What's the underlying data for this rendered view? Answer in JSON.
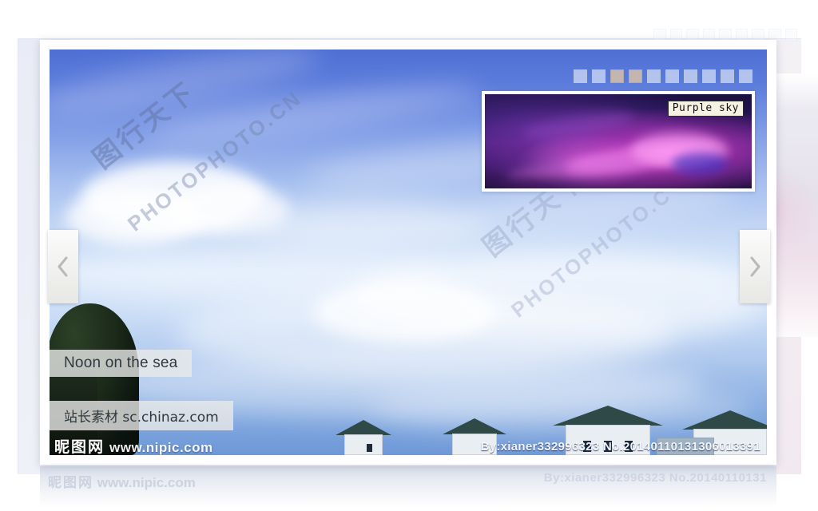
{
  "viewer": {
    "title": "Noon on the sea",
    "subtitle": "站长素材 sc.chinaz.com",
    "credit": "By:xianer332996323  No.20140110131306013391",
    "reflection_credit": "By:xianer332996323  No.20140110131",
    "prev_label": "‹",
    "next_label": "›",
    "prev_icon": "chevron-left-icon",
    "next_icon": "chevron-right-icon"
  },
  "preview": {
    "label": "Purple sky",
    "alt": "purple-sky-thumbnail"
  },
  "pager": {
    "total": 10,
    "active_indices": [
      2,
      3
    ],
    "items": [
      {
        "index": 1,
        "active": false
      },
      {
        "index": 2,
        "active": false
      },
      {
        "index": 3,
        "active": true
      },
      {
        "index": 4,
        "active": true
      },
      {
        "index": 5,
        "active": false
      },
      {
        "index": 6,
        "active": false
      },
      {
        "index": 7,
        "active": false
      },
      {
        "index": 8,
        "active": false
      },
      {
        "index": 9,
        "active": false
      },
      {
        "index": 10,
        "active": false
      }
    ]
  },
  "watermarks": {
    "nipic_cn": "昵图网",
    "nipic_url": "www.nipic.com",
    "photophoto_cn": "图行天下",
    "photophoto_url": "PHOTOPHOTO.CN",
    "photophoto_url2": "PHOTOPHOTO.C"
  },
  "colors": {
    "frame": "#ffffff",
    "pager_active": "#c3b6b0",
    "pager_idle": "#b8c6da",
    "caption_bg": "rgba(232,234,232,0.80)",
    "label_bg": "#f6f2e3",
    "sky_top": "#4f6fd4",
    "sky_mid": "#d7e6fa",
    "purple_dark": "#1a1040",
    "purple_bright": "#ff78eb"
  }
}
